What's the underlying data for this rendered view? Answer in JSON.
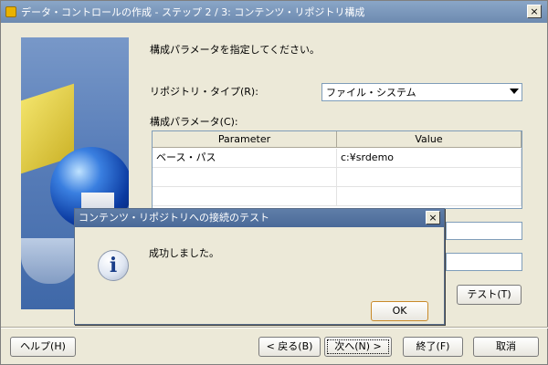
{
  "window": {
    "title": "データ・コントロールの作成 - ステップ 2 / 3: コンテンツ・リポジトリ構成",
    "close_glyph": "×"
  },
  "main": {
    "instruction": "構成パラメータを指定してください。",
    "repo_type_label": "リポジトリ・タイプ(R):",
    "repo_type_value": "ファイル・システム",
    "params_label": "構成パラメータ(C):",
    "table": {
      "headers": [
        "Parameter",
        "Value"
      ],
      "rows": [
        [
          "ベース・パス",
          "c:¥srdemo"
        ],
        [
          "",
          ""
        ],
        [
          "",
          ""
        ]
      ]
    },
    "test_button": "テスト(T)"
  },
  "footer": {
    "help": "ヘルプ(H)",
    "back": "< 戻る(B)",
    "next": "次へ(N) >",
    "finish": "終了(F)",
    "cancel": "取消"
  },
  "modal": {
    "title": "コンテンツ・リポジトリへの接続のテスト",
    "close_glyph": "×",
    "icon_glyph": "i",
    "message": "成功しました。",
    "ok": "OK"
  }
}
